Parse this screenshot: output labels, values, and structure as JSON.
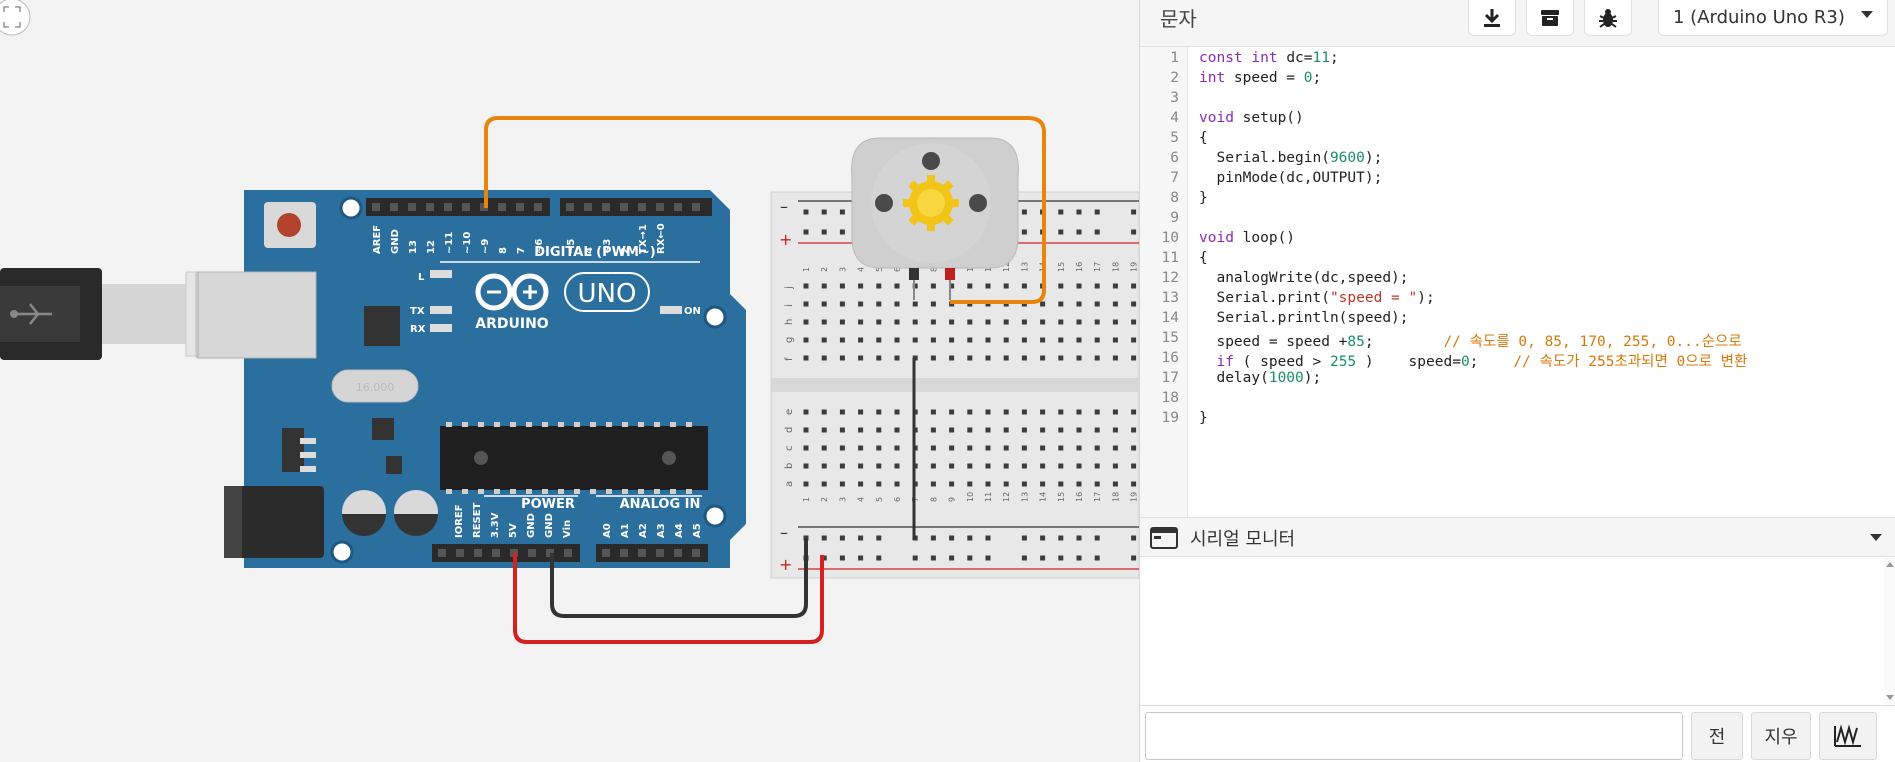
{
  "toolbar": {
    "mode_label": "문자",
    "download_icon": "download-icon",
    "library_icon": "library-icon",
    "debug_icon": "bug-icon",
    "board_select": "1 (Arduino Uno R3)"
  },
  "circuit": {
    "arduino": {
      "brand": "ARDUINO",
      "model": "UNO",
      "digital_label": "DIGITAL (PWM~)",
      "power_label": "POWER",
      "analog_label": "ANALOG IN",
      "on_label": "ON",
      "l_label": "L",
      "tx_label": "TX",
      "rx_label": "RX",
      "crystal_label": "16.000",
      "digital_pins": [
        "AREF",
        "GND",
        "13",
        "12",
        "~11",
        "~10",
        "~9",
        "8",
        "7",
        "~6",
        "~5",
        "4",
        "~3",
        "2",
        "TX→1",
        "RX←0"
      ],
      "power_pins": [
        "IOREF",
        "RESET",
        "3.3V",
        "5V",
        "GND",
        "GND",
        "Vin"
      ],
      "analog_pins": [
        "A0",
        "A1",
        "A2",
        "A3",
        "A4",
        "A5"
      ]
    },
    "breadboard": {
      "rail_minus": "–",
      "rail_plus": "+",
      "row_letters_top": [
        "j",
        "i",
        "h",
        "g",
        "f"
      ],
      "row_letters_bottom": [
        "e",
        "d",
        "c",
        "b",
        "a"
      ],
      "col_numbers": [
        "1",
        "2",
        "3",
        "4",
        "5",
        "6",
        "7",
        "8",
        "9",
        "10",
        "11",
        "12",
        "13",
        "14",
        "15",
        "16",
        "17",
        "18",
        "19"
      ]
    },
    "colors": {
      "board": "#2b6f9e",
      "wire_orange": "#e8850e",
      "wire_red": "#d42020",
      "wire_black": "#333333",
      "motor": "#cfcfcf",
      "gear": "#f2c418"
    }
  },
  "editor": {
    "line_numbers": [
      "1",
      "2",
      "3",
      "4",
      "5",
      "6",
      "7",
      "8",
      "9",
      "10",
      "11",
      "12",
      "13",
      "14",
      "15",
      "16",
      "17",
      "18",
      "19"
    ],
    "lines": [
      "const int dc=11;",
      "int speed = 0;",
      "",
      "void setup()",
      "{",
      "  Serial.begin(9600);",
      "  pinMode(dc,OUTPUT);",
      "}",
      "",
      "void loop()",
      "{",
      "  analogWrite(dc,speed);",
      "  Serial.print(\"speed = \");",
      "  Serial.println(speed);",
      "  speed = speed +85;        // 속도를 0, 85, 170, 255, 0...순으로",
      "  if ( speed > 255 )    speed=0;    // 속도가 255초과되면 0으로 변환",
      "  delay(1000);",
      "",
      "}"
    ]
  },
  "serial": {
    "title": "시리얼 모니터",
    "send_label": "전",
    "clear_label": "지우",
    "graph_icon": "graph-icon",
    "input_value": ""
  }
}
